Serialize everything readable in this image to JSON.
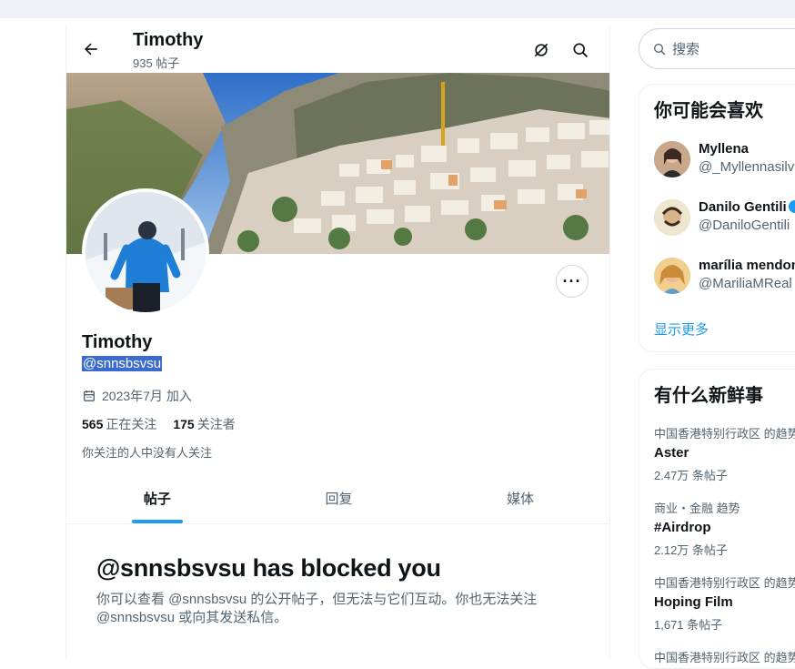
{
  "header": {
    "title": "Timothy",
    "post_count": "935 帖子"
  },
  "profile": {
    "name": "Timothy",
    "handle": "@snnsbsvsu",
    "joined": "2023年7月 加入",
    "following_count": "565",
    "following_label": "正在关注",
    "followers_count": "175",
    "followers_label": "关注者",
    "mutuals_note": "你关注的人中没有人关注"
  },
  "tabs": [
    {
      "label": "帖子",
      "active": true
    },
    {
      "label": "回复",
      "active": false
    },
    {
      "label": "媒体",
      "active": false
    }
  ],
  "blocked": {
    "title": "@snnsbsvsu has blocked you",
    "body": "你可以查看 @snnsbsvsu 的公开帖子，但无法与它们互动。你也无法关注 @snnsbsvsu 或向其发送私信。"
  },
  "search": {
    "placeholder": "搜索"
  },
  "who_to_follow": {
    "title": "你可能会喜欢",
    "users": [
      {
        "name": "Myllena",
        "handle": "@_Myllennasilva",
        "verified": false
      },
      {
        "name": "Danilo Gentili",
        "handle": "@DaniloGentili",
        "verified": true
      },
      {
        "name": "marília mendonça",
        "handle": "@MariliaMReal",
        "verified": false
      }
    ],
    "show_more": "显示更多"
  },
  "trends": {
    "title": "有什么新鲜事",
    "items": [
      {
        "context": "中国香港特别行政区 的趋势",
        "topic": "Aster",
        "count": "2.47万 条帖子"
      },
      {
        "context": "商业・金融 趋势",
        "topic": "#Airdrop",
        "count": "2.12万 条帖子"
      },
      {
        "context": "中国香港特别行政区 的趋势",
        "topic": "Hoping Film",
        "count": "1,671 条帖子"
      },
      {
        "context": "中国香港特别行政区 的趋势",
        "topic": "",
        "count": ""
      }
    ]
  },
  "colors": {
    "accent": "#1d9bf0",
    "text_primary": "#0f1419",
    "text_secondary": "#536471",
    "selection": "#3b6ad0"
  }
}
